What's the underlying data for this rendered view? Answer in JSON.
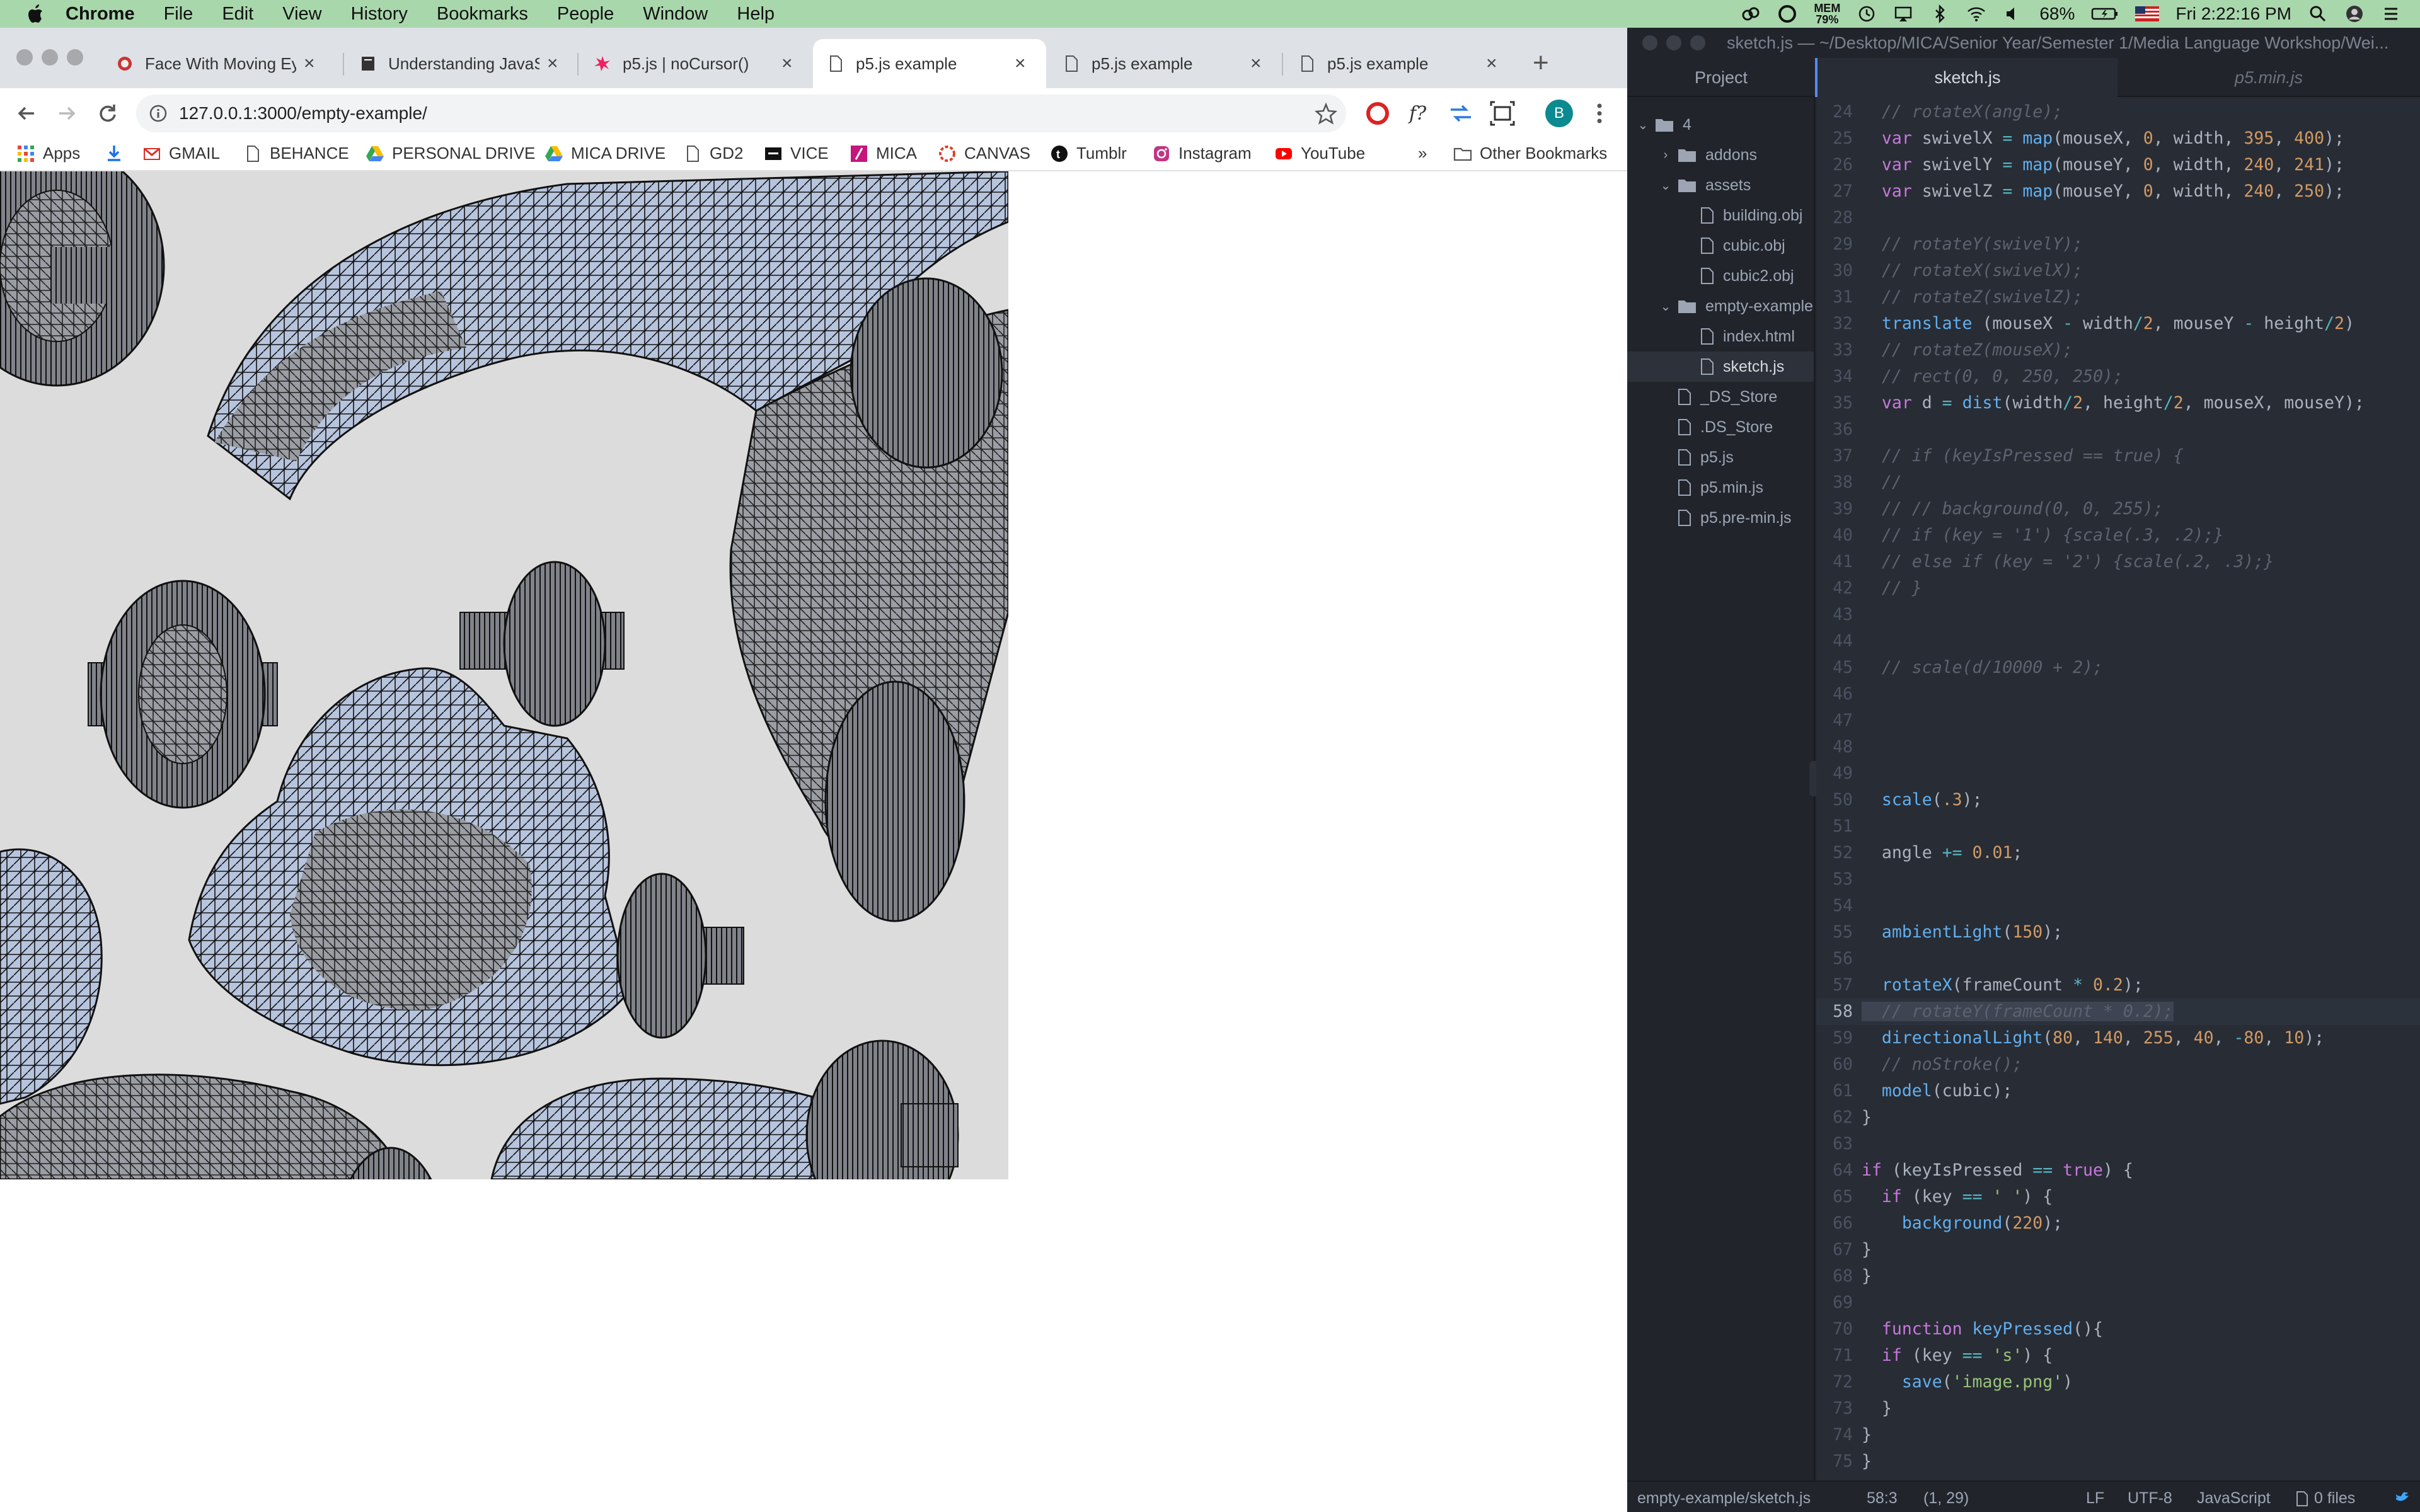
{
  "menubar": {
    "items": [
      "Chrome",
      "File",
      "Edit",
      "View",
      "History",
      "Bookmarks",
      "People",
      "Window",
      "Help"
    ],
    "status": {
      "mem_label": "MEM",
      "mem_value": "79%",
      "battery": "68%",
      "clock": "Fri 2:22:16 PM"
    }
  },
  "chrome": {
    "tabs": [
      {
        "title": "Face With Moving Eye",
        "close": "×"
      },
      {
        "title": "Understanding JavaSc",
        "close": "×"
      },
      {
        "title": "p5.js | noCursor()",
        "close": "×"
      },
      {
        "title": "p5.js example",
        "close": "×"
      },
      {
        "title": "p5.js example",
        "close": "×"
      },
      {
        "title": "p5.js example",
        "close": "×"
      }
    ],
    "new_tab": "+",
    "url": "127.0.0.1:3000/empty-example/",
    "profile_initial": "B",
    "bookmarks": [
      "Apps",
      "GMAIL",
      "BEHANCE",
      "PERSONAL DRIVE",
      "MICA DRIVE",
      "GD2",
      "VICE",
      "MICA",
      "CANVAS",
      "Tumblr",
      "Instagram",
      "YouTube"
    ],
    "overflow": "»",
    "other_bookmarks": "Other Bookmarks"
  },
  "atom": {
    "title": "sketch.js — ~/Desktop/MICA/Senior Year/Semester 1/Media Language Workshop/Wei...",
    "tabs": {
      "project": "Project",
      "sketch": "sketch.js",
      "min": "p5.min.js"
    },
    "tree": [
      {
        "label": "4",
        "kind": "folder-open",
        "indent": 0
      },
      {
        "label": "addons",
        "kind": "folder-closed",
        "indent": 1
      },
      {
        "label": "assets",
        "kind": "folder-open",
        "indent": 1
      },
      {
        "label": "building.obj",
        "kind": "file",
        "indent": 2
      },
      {
        "label": "cubic.obj",
        "kind": "file",
        "indent": 2
      },
      {
        "label": "cubic2.obj",
        "kind": "file",
        "indent": 2
      },
      {
        "label": "empty-example",
        "kind": "folder-open",
        "indent": 1
      },
      {
        "label": "index.html",
        "kind": "file",
        "indent": 2
      },
      {
        "label": "sketch.js",
        "kind": "file",
        "indent": 2,
        "selected": true
      },
      {
        "label": "_DS_Store",
        "kind": "file",
        "indent": 1
      },
      {
        "label": ".DS_Store",
        "kind": "file",
        "indent": 1
      },
      {
        "label": "p5.js",
        "kind": "file",
        "indent": 1
      },
      {
        "label": "p5.min.js",
        "kind": "file",
        "indent": 1
      },
      {
        "label": "p5.pre-min.js",
        "kind": "file",
        "indent": 1
      }
    ],
    "code": [
      {
        "n": "24",
        "t": "  // rotateX(angle);"
      },
      {
        "n": "25",
        "t": "  var swivelX = map(mouseX, 0, width, 395, 400);"
      },
      {
        "n": "26",
        "t": "  var swivelY = map(mouseY, 0, width, 240, 241);"
      },
      {
        "n": "27",
        "t": "  var swivelZ = map(mouseY, 0, width, 240, 250);"
      },
      {
        "n": "28",
        "t": ""
      },
      {
        "n": "29",
        "t": "  // rotateY(swivelY);"
      },
      {
        "n": "30",
        "t": "  // rotateX(swivelX);"
      },
      {
        "n": "31",
        "t": "  // rotateZ(swivelZ);"
      },
      {
        "n": "32",
        "t": "  translate (mouseX - width/2, mouseY - height/2)"
      },
      {
        "n": "33",
        "t": "  // rotateZ(mouseX);"
      },
      {
        "n": "34",
        "t": "  // rect(0, 0, 250, 250);"
      },
      {
        "n": "35",
        "t": "  var d = dist(width/2, height/2, mouseX, mouseY);"
      },
      {
        "n": "36",
        "t": ""
      },
      {
        "n": "37",
        "t": "  // if (keyIsPressed == true) {"
      },
      {
        "n": "38",
        "t": "  //"
      },
      {
        "n": "39",
        "t": "  // // background(0, 0, 255);"
      },
      {
        "n": "40",
        "t": "  // if (key = '1') {scale(.3, .2);}"
      },
      {
        "n": "41",
        "t": "  // else if (key = '2') {scale(.2, .3);}"
      },
      {
        "n": "42",
        "t": "  // }"
      },
      {
        "n": "43",
        "t": ""
      },
      {
        "n": "44",
        "t": ""
      },
      {
        "n": "45",
        "t": "  // scale(d/10000 + 2);"
      },
      {
        "n": "46",
        "t": ""
      },
      {
        "n": "47",
        "t": ""
      },
      {
        "n": "48",
        "t": ""
      },
      {
        "n": "49",
        "t": ""
      },
      {
        "n": "50",
        "t": "  scale(.3);"
      },
      {
        "n": "51",
        "t": ""
      },
      {
        "n": "52",
        "t": "  angle += 0.01;"
      },
      {
        "n": "53",
        "t": ""
      },
      {
        "n": "54",
        "t": ""
      },
      {
        "n": "55",
        "t": "  ambientLight(150);"
      },
      {
        "n": "56",
        "t": ""
      },
      {
        "n": "57",
        "t": "  rotateX(frameCount * 0.2);"
      },
      {
        "n": "58",
        "t": "  // rotateY(frameCount * 0.2);"
      },
      {
        "n": "59",
        "t": "  directionalLight(80, 140, 255, 40, -80, 10);"
      },
      {
        "n": "60",
        "t": "  // noStroke();"
      },
      {
        "n": "61",
        "t": "  model(cubic);"
      },
      {
        "n": "62",
        "t": "}"
      },
      {
        "n": "63",
        "t": ""
      },
      {
        "n": "64",
        "t": "if (keyIsPressed == true) {"
      },
      {
        "n": "65",
        "t": "  if (key == ' ') {"
      },
      {
        "n": "66",
        "t": "    background(220);"
      },
      {
        "n": "67",
        "t": "}"
      },
      {
        "n": "68",
        "t": "}"
      },
      {
        "n": "69",
        "t": ""
      },
      {
        "n": "70",
        "t": "  function keyPressed(){"
      },
      {
        "n": "71",
        "t": "  if (key == 's') {"
      },
      {
        "n": "72",
        "t": "    save('image.png')"
      },
      {
        "n": "73",
        "t": "  }"
      },
      {
        "n": "74",
        "t": "}"
      },
      {
        "n": "75",
        "t": "}"
      }
    ],
    "status": {
      "path": "empty-example/sketch.js",
      "cursor": "58:3",
      "selection": "(1, 29)",
      "eol": "LF",
      "encoding": "UTF-8",
      "grammar": "JavaScript",
      "files": "0 files"
    }
  },
  "colors": {
    "menubar_bg": "#a9d7ac",
    "atom_bg": "#282c34",
    "chrome_tabbar": "#dee1e6",
    "canvas_bg": "#dcdcdc"
  }
}
